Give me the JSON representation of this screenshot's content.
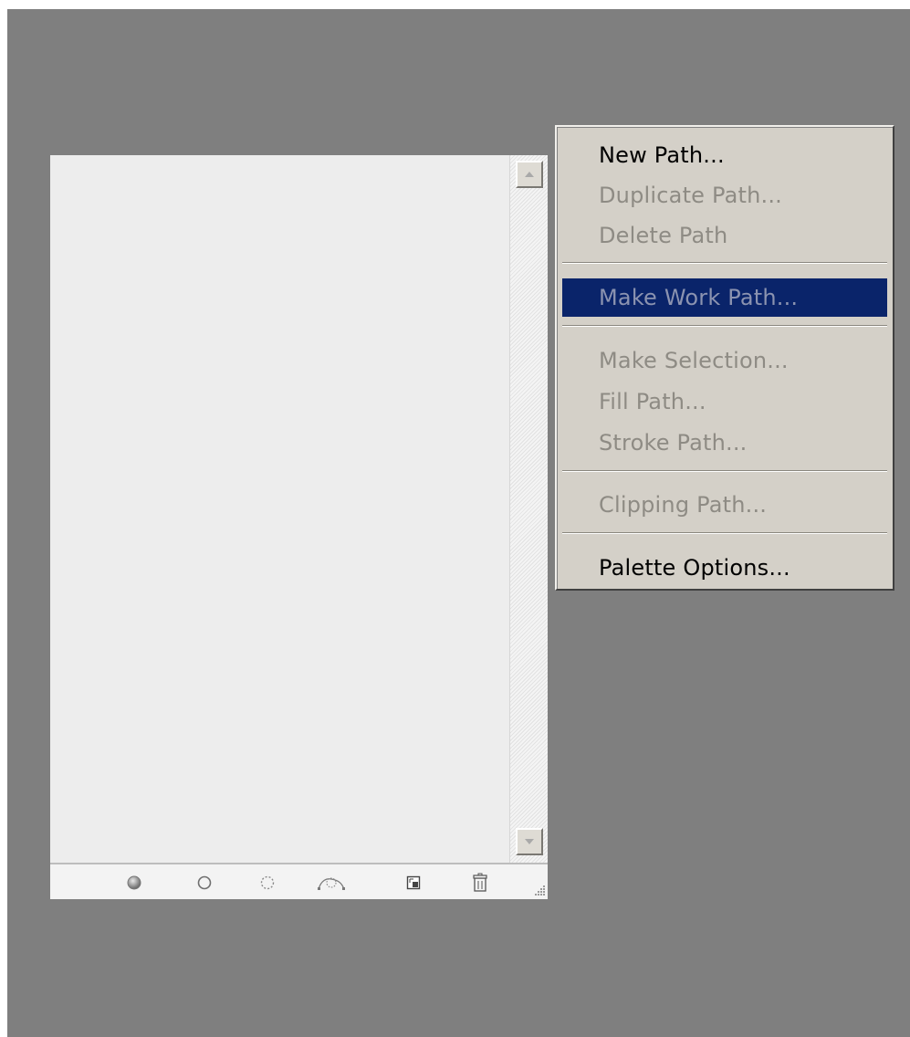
{
  "palette": {
    "name": "Paths palette",
    "scrollbar": {
      "up_icon": "arrow-up-icon",
      "down_icon": "arrow-down-icon"
    },
    "bottom_tools": [
      {
        "name": "fill-path-icon",
        "tooltip": ""
      },
      {
        "name": "stroke-path-icon",
        "tooltip": ""
      },
      {
        "name": "load-path-as-selection-icon",
        "tooltip": ""
      },
      {
        "name": "make-work-path-icon",
        "tooltip": ""
      },
      {
        "name": "new-path-icon",
        "tooltip": ""
      },
      {
        "name": "delete-path-icon",
        "tooltip": ""
      }
    ]
  },
  "menu": {
    "items": [
      {
        "label": "New Path...",
        "state": "enabled"
      },
      {
        "label": "Duplicate Path...",
        "state": "disabled"
      },
      {
        "label": "Delete Path",
        "state": "disabled"
      },
      {
        "label": "Make Work Path...",
        "state": "highlighted"
      },
      {
        "label": "Make Selection...",
        "state": "disabled"
      },
      {
        "label": "Fill Path...",
        "state": "disabled"
      },
      {
        "label": "Stroke Path...",
        "state": "disabled"
      },
      {
        "label": "Clipping Path...",
        "state": "disabled"
      },
      {
        "label": "Palette Options...",
        "state": "enabled"
      }
    ]
  },
  "colors": {
    "backdrop": "#7f7f7f",
    "menu_bg": "#d4d0c8",
    "highlight_bg": "#0a246a",
    "disabled_text": "#8e8b84",
    "palette_bg": "#ededed"
  }
}
